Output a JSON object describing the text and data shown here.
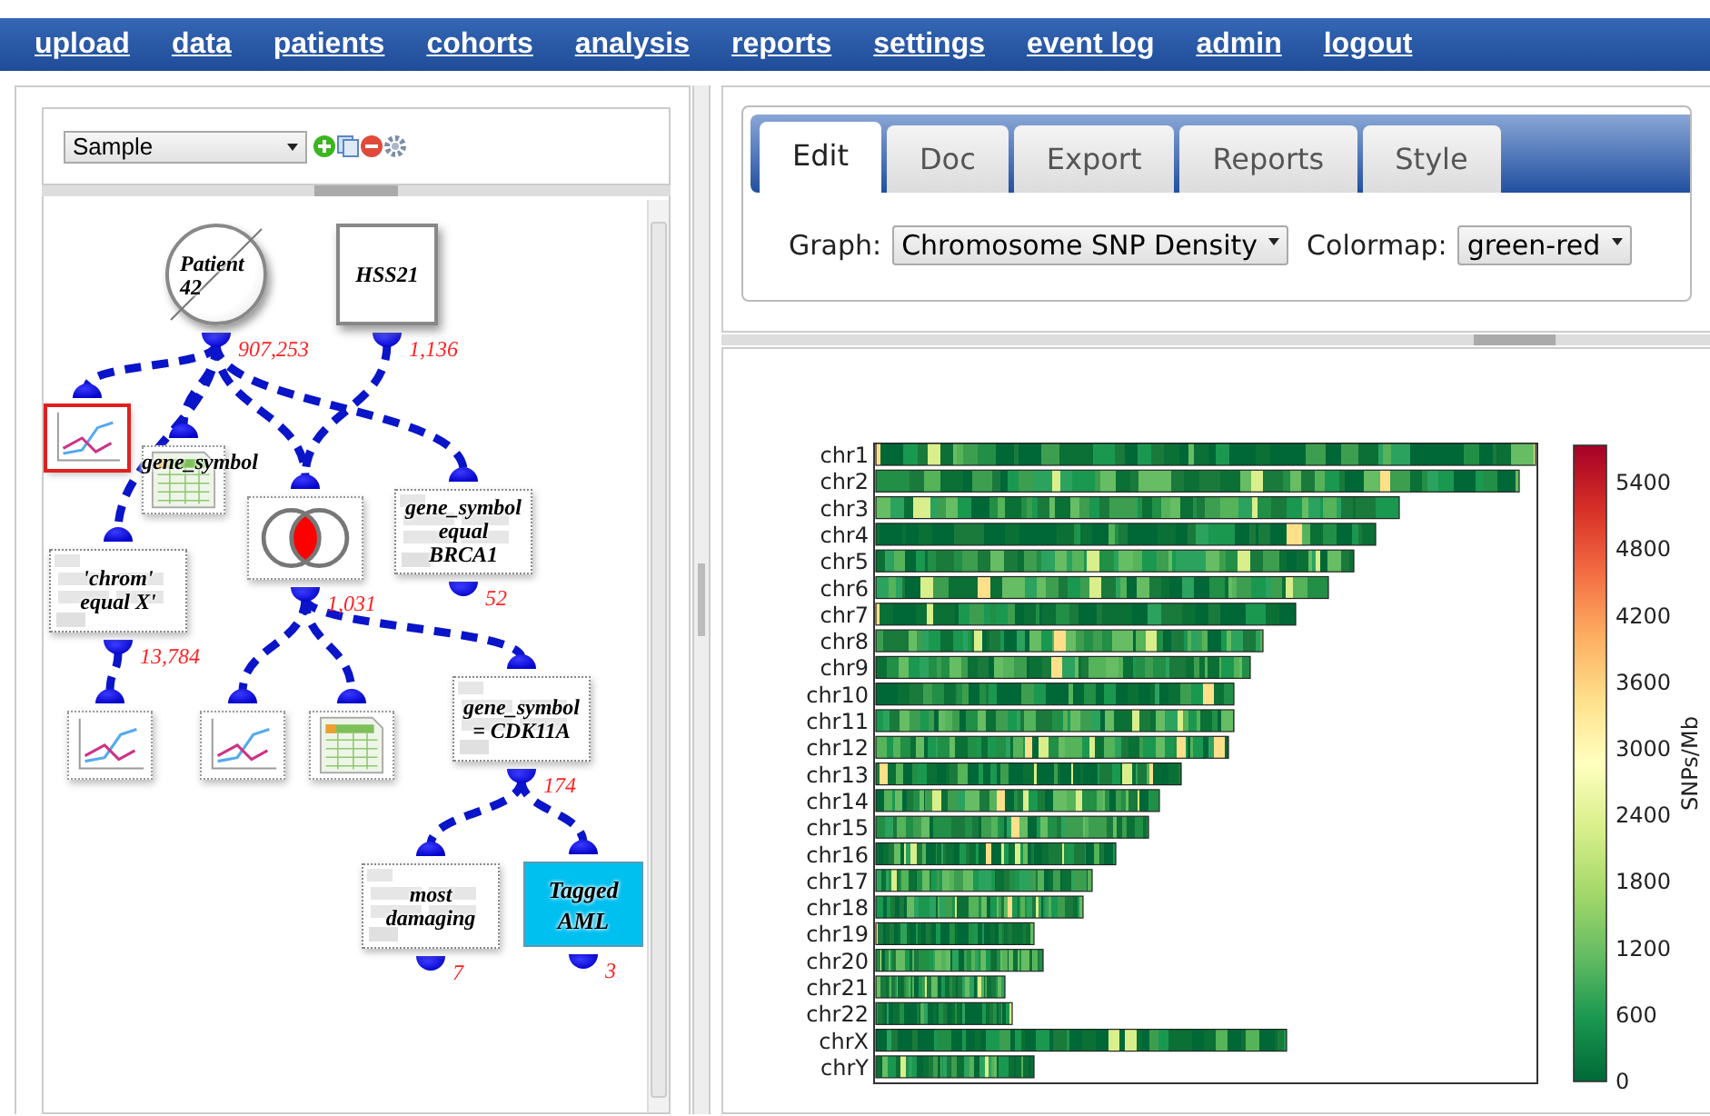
{
  "nav": [
    {
      "label": "upload"
    },
    {
      "label": "data"
    },
    {
      "label": "patients"
    },
    {
      "label": "cohorts"
    },
    {
      "label": "analysis"
    },
    {
      "label": "reports"
    },
    {
      "label": "settings"
    },
    {
      "label": "event log"
    },
    {
      "label": "admin"
    },
    {
      "label": "logout"
    }
  ],
  "sample_select": {
    "value": "Sample"
  },
  "nodes": [
    {
      "kind": "patient",
      "label": "Patient 42",
      "count": "907,253",
      "selected": false
    },
    {
      "kind": "sample",
      "label": "HSS21",
      "count": "1,136",
      "selected": false
    },
    {
      "kind": "chart",
      "selected": true
    },
    {
      "kind": "table",
      "label": "gene_symbol",
      "selected": false
    },
    {
      "kind": "venn",
      "count": "1,031",
      "selected": false
    },
    {
      "kind": "filter",
      "label": "gene_symbol equal BRCA1",
      "count": "52",
      "selected": false
    },
    {
      "kind": "filter",
      "label": "'chrom' equal X'",
      "count": "13,784",
      "selected": false
    },
    {
      "kind": "chart",
      "selected": false
    },
    {
      "kind": "chart",
      "selected": false
    },
    {
      "kind": "table",
      "selected": false
    },
    {
      "kind": "filter",
      "label": "gene_symbol = CDK11A",
      "count": "174",
      "selected": false
    },
    {
      "kind": "filter",
      "label": "most damaging",
      "count": "7",
      "selected": false
    },
    {
      "kind": "tag",
      "label": "Tagged AML",
      "count": "3",
      "selected": false
    }
  ],
  "tabs": [
    {
      "label": "Edit",
      "selected": true
    },
    {
      "label": "Doc",
      "selected": false
    },
    {
      "label": "Export",
      "selected": false
    },
    {
      "label": "Reports",
      "selected": false
    },
    {
      "label": "Style",
      "selected": false
    }
  ],
  "graph": {
    "label": "Graph:",
    "value": "Chromosome SNP Density"
  },
  "colormap": {
    "label": "Colormap:",
    "value": "green-red"
  },
  "heatmap": {
    "rows": [
      "chr1",
      "chr2",
      "chr3",
      "chr4",
      "chr5",
      "chr6",
      "chr7",
      "chr8",
      "chr9",
      "chr10",
      "chr11",
      "chr12",
      "chr13",
      "chr14",
      "chr15",
      "chr16",
      "chr17",
      "chr18",
      "chr19",
      "chr20",
      "chr21",
      "chr22",
      "chrX",
      "chrY"
    ],
    "colorbar": {
      "title": "SNPs/Mb",
      "ticks": [
        "5400",
        "4800",
        "4200",
        "3600",
        "3000",
        "2400",
        "1800",
        "1200",
        "600",
        "0"
      ]
    }
  }
}
